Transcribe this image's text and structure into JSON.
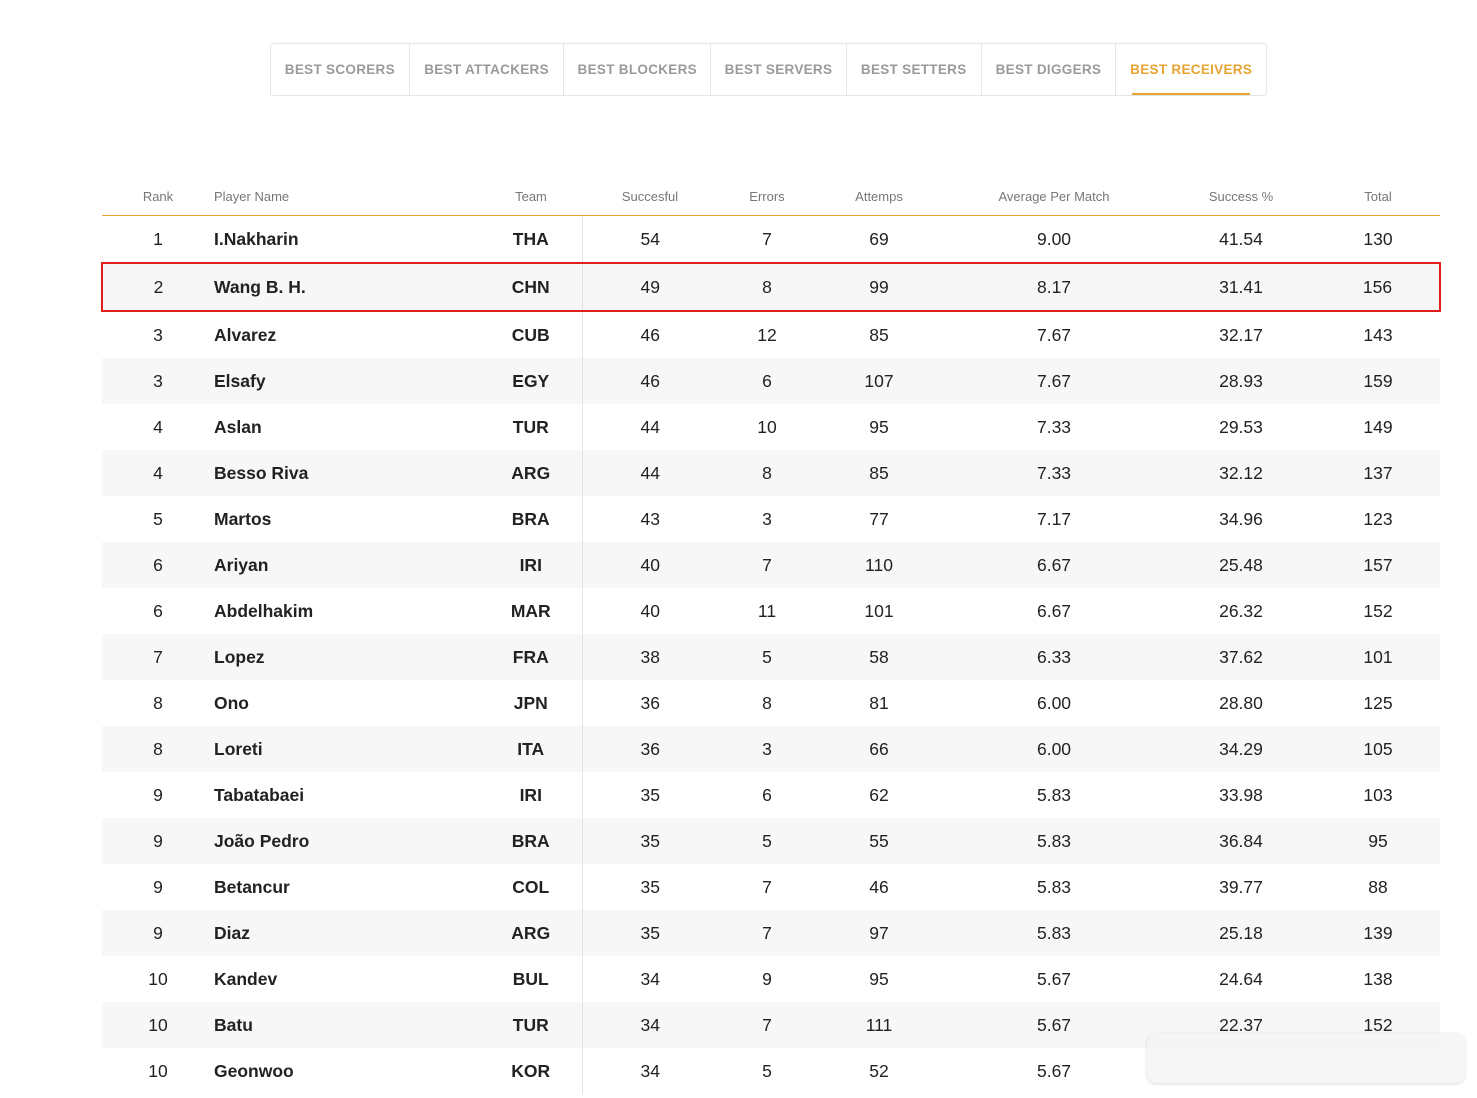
{
  "tabs": [
    {
      "label": "BEST SCORERS",
      "active": false
    },
    {
      "label": "BEST ATTACKERS",
      "active": false
    },
    {
      "label": "BEST BLOCKERS",
      "active": false
    },
    {
      "label": "BEST SERVERS",
      "active": false
    },
    {
      "label": "BEST SETTERS",
      "active": false
    },
    {
      "label": "BEST DIGGERS",
      "active": false
    },
    {
      "label": "BEST RECEIVERS",
      "active": true
    }
  ],
  "accent_color": "#e8a432",
  "highlight_color": "#e02020",
  "table": {
    "headers": {
      "rank": "Rank",
      "player": "Player Name",
      "team": "Team",
      "successful": "Succesful",
      "errors": "Errors",
      "attempts": "Attemps",
      "average": "Average Per Match",
      "success_pct": "Success %",
      "total": "Total"
    },
    "highlighted_row": 1,
    "rows": [
      [
        "1",
        "I.Nakharin",
        "THA",
        "54",
        "7",
        "69",
        "9.00",
        "41.54",
        "130"
      ],
      [
        "2",
        "Wang B. H.",
        "CHN",
        "49",
        "8",
        "99",
        "8.17",
        "31.41",
        "156"
      ],
      [
        "3",
        "Alvarez",
        "CUB",
        "46",
        "12",
        "85",
        "7.67",
        "32.17",
        "143"
      ],
      [
        "3",
        "Elsafy",
        "EGY",
        "46",
        "6",
        "107",
        "7.67",
        "28.93",
        "159"
      ],
      [
        "4",
        "Aslan",
        "TUR",
        "44",
        "10",
        "95",
        "7.33",
        "29.53",
        "149"
      ],
      [
        "4",
        "Besso Riva",
        "ARG",
        "44",
        "8",
        "85",
        "7.33",
        "32.12",
        "137"
      ],
      [
        "5",
        "Martos",
        "BRA",
        "43",
        "3",
        "77",
        "7.17",
        "34.96",
        "123"
      ],
      [
        "6",
        "Ariyan",
        "IRI",
        "40",
        "7",
        "110",
        "6.67",
        "25.48",
        "157"
      ],
      [
        "6",
        "Abdelhakim",
        "MAR",
        "40",
        "11",
        "101",
        "6.67",
        "26.32",
        "152"
      ],
      [
        "7",
        "Lopez",
        "FRA",
        "38",
        "5",
        "58",
        "6.33",
        "37.62",
        "101"
      ],
      [
        "8",
        "Ono",
        "JPN",
        "36",
        "8",
        "81",
        "6.00",
        "28.80",
        "125"
      ],
      [
        "8",
        "Loreti",
        "ITA",
        "36",
        "3",
        "66",
        "6.00",
        "34.29",
        "105"
      ],
      [
        "9",
        "Tabatabaei",
        "IRI",
        "35",
        "6",
        "62",
        "5.83",
        "33.98",
        "103"
      ],
      [
        "9",
        "João Pedro",
        "BRA",
        "35",
        "5",
        "55",
        "5.83",
        "36.84",
        "95"
      ],
      [
        "9",
        "Betancur",
        "COL",
        "35",
        "7",
        "46",
        "5.83",
        "39.77",
        "88"
      ],
      [
        "9",
        "Diaz",
        "ARG",
        "35",
        "7",
        "97",
        "5.83",
        "25.18",
        "139"
      ],
      [
        "10",
        "Kandev",
        "BUL",
        "34",
        "9",
        "95",
        "5.67",
        "24.64",
        "138"
      ],
      [
        "10",
        "Batu",
        "TUR",
        "34",
        "7",
        "111",
        "5.67",
        "22.37",
        "152"
      ],
      [
        "10",
        "Geonwoo",
        "KOR",
        "34",
        "5",
        "52",
        "5.67",
        "",
        ""
      ]
    ]
  }
}
